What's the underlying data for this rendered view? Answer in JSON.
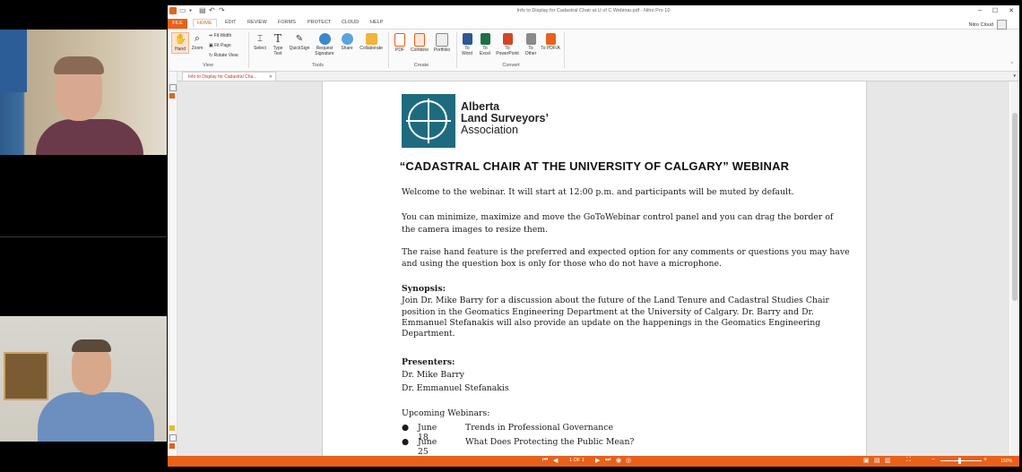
{
  "app": {
    "window_title": "Info to Display for Cadastral Chair at U of C Webinar.pdf - Nitro Pro 10",
    "account": "Nitro Cloud"
  },
  "ribbon_tabs": [
    "FILE",
    "HOME",
    "EDIT",
    "REVIEW",
    "FORMS",
    "PROTECT",
    "CLOUD",
    "HELP"
  ],
  "ribbon": {
    "view": {
      "hand": "Hand",
      "zoom": "Zoom",
      "fit_width": "Fit Width",
      "fit_page": "Fit Page",
      "rotate": "Rotate View",
      "label": "View"
    },
    "tools": {
      "select": "Select",
      "type_text": "Type Text",
      "quicksign": "QuickSign",
      "request_signature": "Request Signature",
      "share": "Share",
      "collaborate": "Collaborate",
      "label": "Tools"
    },
    "create": {
      "pdf": "PDF",
      "combine": "Combine",
      "portfolio": "Portfolio",
      "label": "Create"
    },
    "convert": {
      "to_word": "To Word",
      "to_excel": "To Excel",
      "to_powerpoint": "To PowerPoint",
      "to_other": "To Other",
      "to_pdfa": "To PDF/A",
      "label": "Convert"
    }
  },
  "doc_tab": {
    "title": "Info to Display for Cadastral Cha..."
  },
  "document": {
    "logo_line1": "Alberta",
    "logo_line2": "Land Surveyors’",
    "logo_line3": "Association",
    "heading": "“CADASTRAL CHAIR AT THE UNIVERSITY OF CALGARY” WEBINAR",
    "p1": "Welcome to the webinar. It will start at 12:00 p.m. and participants will be muted by default.",
    "p2a": "You can minimize, maximize and move the GoToWebinar control panel and you can drag the border of",
    "p2b": "the camera images to resize them.",
    "p3a": "The raise hand feature is the preferred and expected option for any comments or questions you may have",
    "p3b": "and using the question box is only for those who do not have a microphone.",
    "synopsis_label": "Synopsis:",
    "s1": "Join Dr. Mike Barry for a discussion about the future of the Land Tenure and Cadastral Studies Chair",
    "s2": "position in the Geomatics Engineering Department at the University of Calgary. Dr. Barry and Dr.",
    "s3": "Emmanuel Stefanakis will also provide an update on the happenings in the Geomatics Engineering",
    "s4": "Department.",
    "presenters_label": "Presenters:",
    "presenter1": "Dr. Mike Barry",
    "presenter2": "Dr. Emmanuel Stefanakis",
    "upcoming_label": "Upcoming Webinars:",
    "webinars": [
      {
        "date": "June 18",
        "title": "Trends in Professional Governance"
      },
      {
        "date": "June 25",
        "title": "What Does Protecting the Public Mean?"
      }
    ]
  },
  "status": {
    "page": "1 OF 1",
    "zoom": "150%"
  },
  "colors": {
    "accent": "#e8611a",
    "logo_teal": "#1e6b80"
  }
}
